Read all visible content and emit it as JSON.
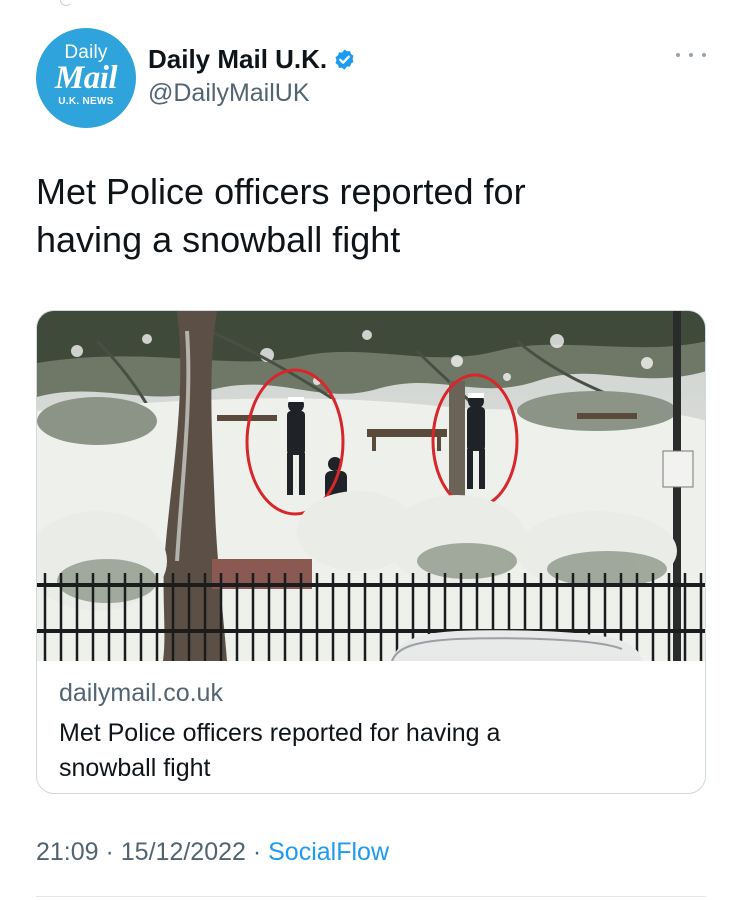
{
  "account": {
    "avatar_line1": "Daily",
    "avatar_line2": "Mail",
    "avatar_line3": "U.K. NEWS",
    "display_name": "Daily Mail U.K.",
    "handle": "@DailyMailUK",
    "verified": true,
    "avatar_color": "#2fa3db",
    "verified_color": "#1d9bf0"
  },
  "tweet": {
    "text_line1": "Met Police officers reported for",
    "text_line2": "having a snowball fight"
  },
  "card": {
    "image_icon": "snowy-park-photo",
    "domain": "dailymail.co.uk",
    "title": "Met Police officers reported for having a snowball fight"
  },
  "meta": {
    "time": "21:09",
    "separator1": " · ",
    "date": "15/12/2022",
    "separator2": " · ",
    "source": "SocialFlow"
  },
  "icons": {
    "more": "more-options-icon",
    "verified": "verified-badge-icon"
  },
  "colors": {
    "text": "#0f1419",
    "secondary": "#536471",
    "link": "#1d9bf0",
    "border": "#cfd9de"
  }
}
